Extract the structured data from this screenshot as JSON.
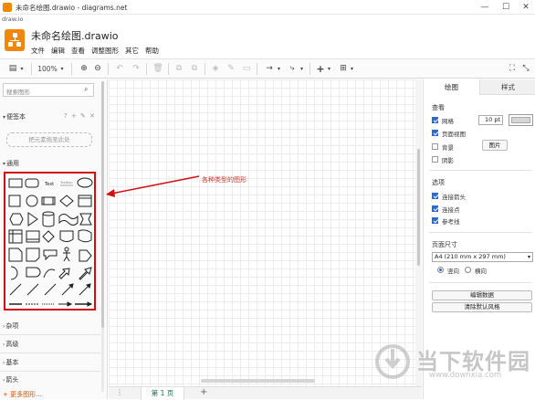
{
  "window": {
    "title": "未命名绘图.drawio - diagrams.net",
    "url": "draw.io",
    "controls": {
      "minimize": "—",
      "maximize": "☐",
      "close": "✕"
    }
  },
  "app": {
    "doc_title": "未命名绘图.drawio",
    "menus": [
      "文件",
      "编辑",
      "查看",
      "调整图形",
      "其它",
      "帮助"
    ]
  },
  "toolbar": {
    "zoom": "100%",
    "icons": [
      "page-view-icon",
      "zoom-in-icon",
      "zoom-out-icon",
      "undo-icon",
      "redo-icon",
      "delete-icon",
      "to-front-icon",
      "to-back-icon",
      "fill-color-icon",
      "line-color-icon",
      "shadow-icon",
      "connection-icon",
      "waypoints-icon",
      "insert-icon",
      "table-icon",
      "fullscreen-icon",
      "collapse-icon"
    ]
  },
  "sidebar": {
    "search_placeholder": "搜索图形",
    "sections": {
      "favorites": "便签本",
      "favorites_tools": "? + ✎ ✕",
      "dropzone": "把元素拖至此处",
      "general": "通用",
      "misc": "杂项",
      "advanced": "高级",
      "basic": "基本",
      "arrows": "箭头"
    },
    "more_shapes": "+ 更多图形..."
  },
  "canvas": {
    "annotation": "各种类型的图形",
    "page_tab": "第 1 页",
    "page_menu_icon": "⋮",
    "add_page": "+"
  },
  "format_panel": {
    "tabs": [
      "绘图",
      "样式"
    ],
    "view_section": "查看",
    "grid_label": "网格",
    "grid_size": "10 pt",
    "page_view_label": "页面视图",
    "background_label": "背景",
    "image_button": "图片",
    "shadow_label": "阴影",
    "options_section": "选项",
    "connection_arrows": "连接箭头",
    "connection_points": "连接点",
    "guides": "参考线",
    "paper_size_section": "页面尺寸",
    "paper_size": "A4 (210 mm x 297 mm)",
    "portrait": "竖向",
    "landscape": "横向",
    "edit_data_button": "编辑数据",
    "clear_default_style_button": "清除默认风格",
    "checks": {
      "grid": true,
      "page_view": true,
      "background": false,
      "shadow": false,
      "connection_arrows": true,
      "connection_points": true,
      "guides": true
    },
    "orientation": "portrait"
  },
  "watermark": {
    "brand": "当下软件园",
    "site": "www.downxia.com"
  },
  "colors": {
    "accent": "#f08705",
    "highlight_box": "#d20f0f",
    "selected": "#2a6bd1"
  }
}
